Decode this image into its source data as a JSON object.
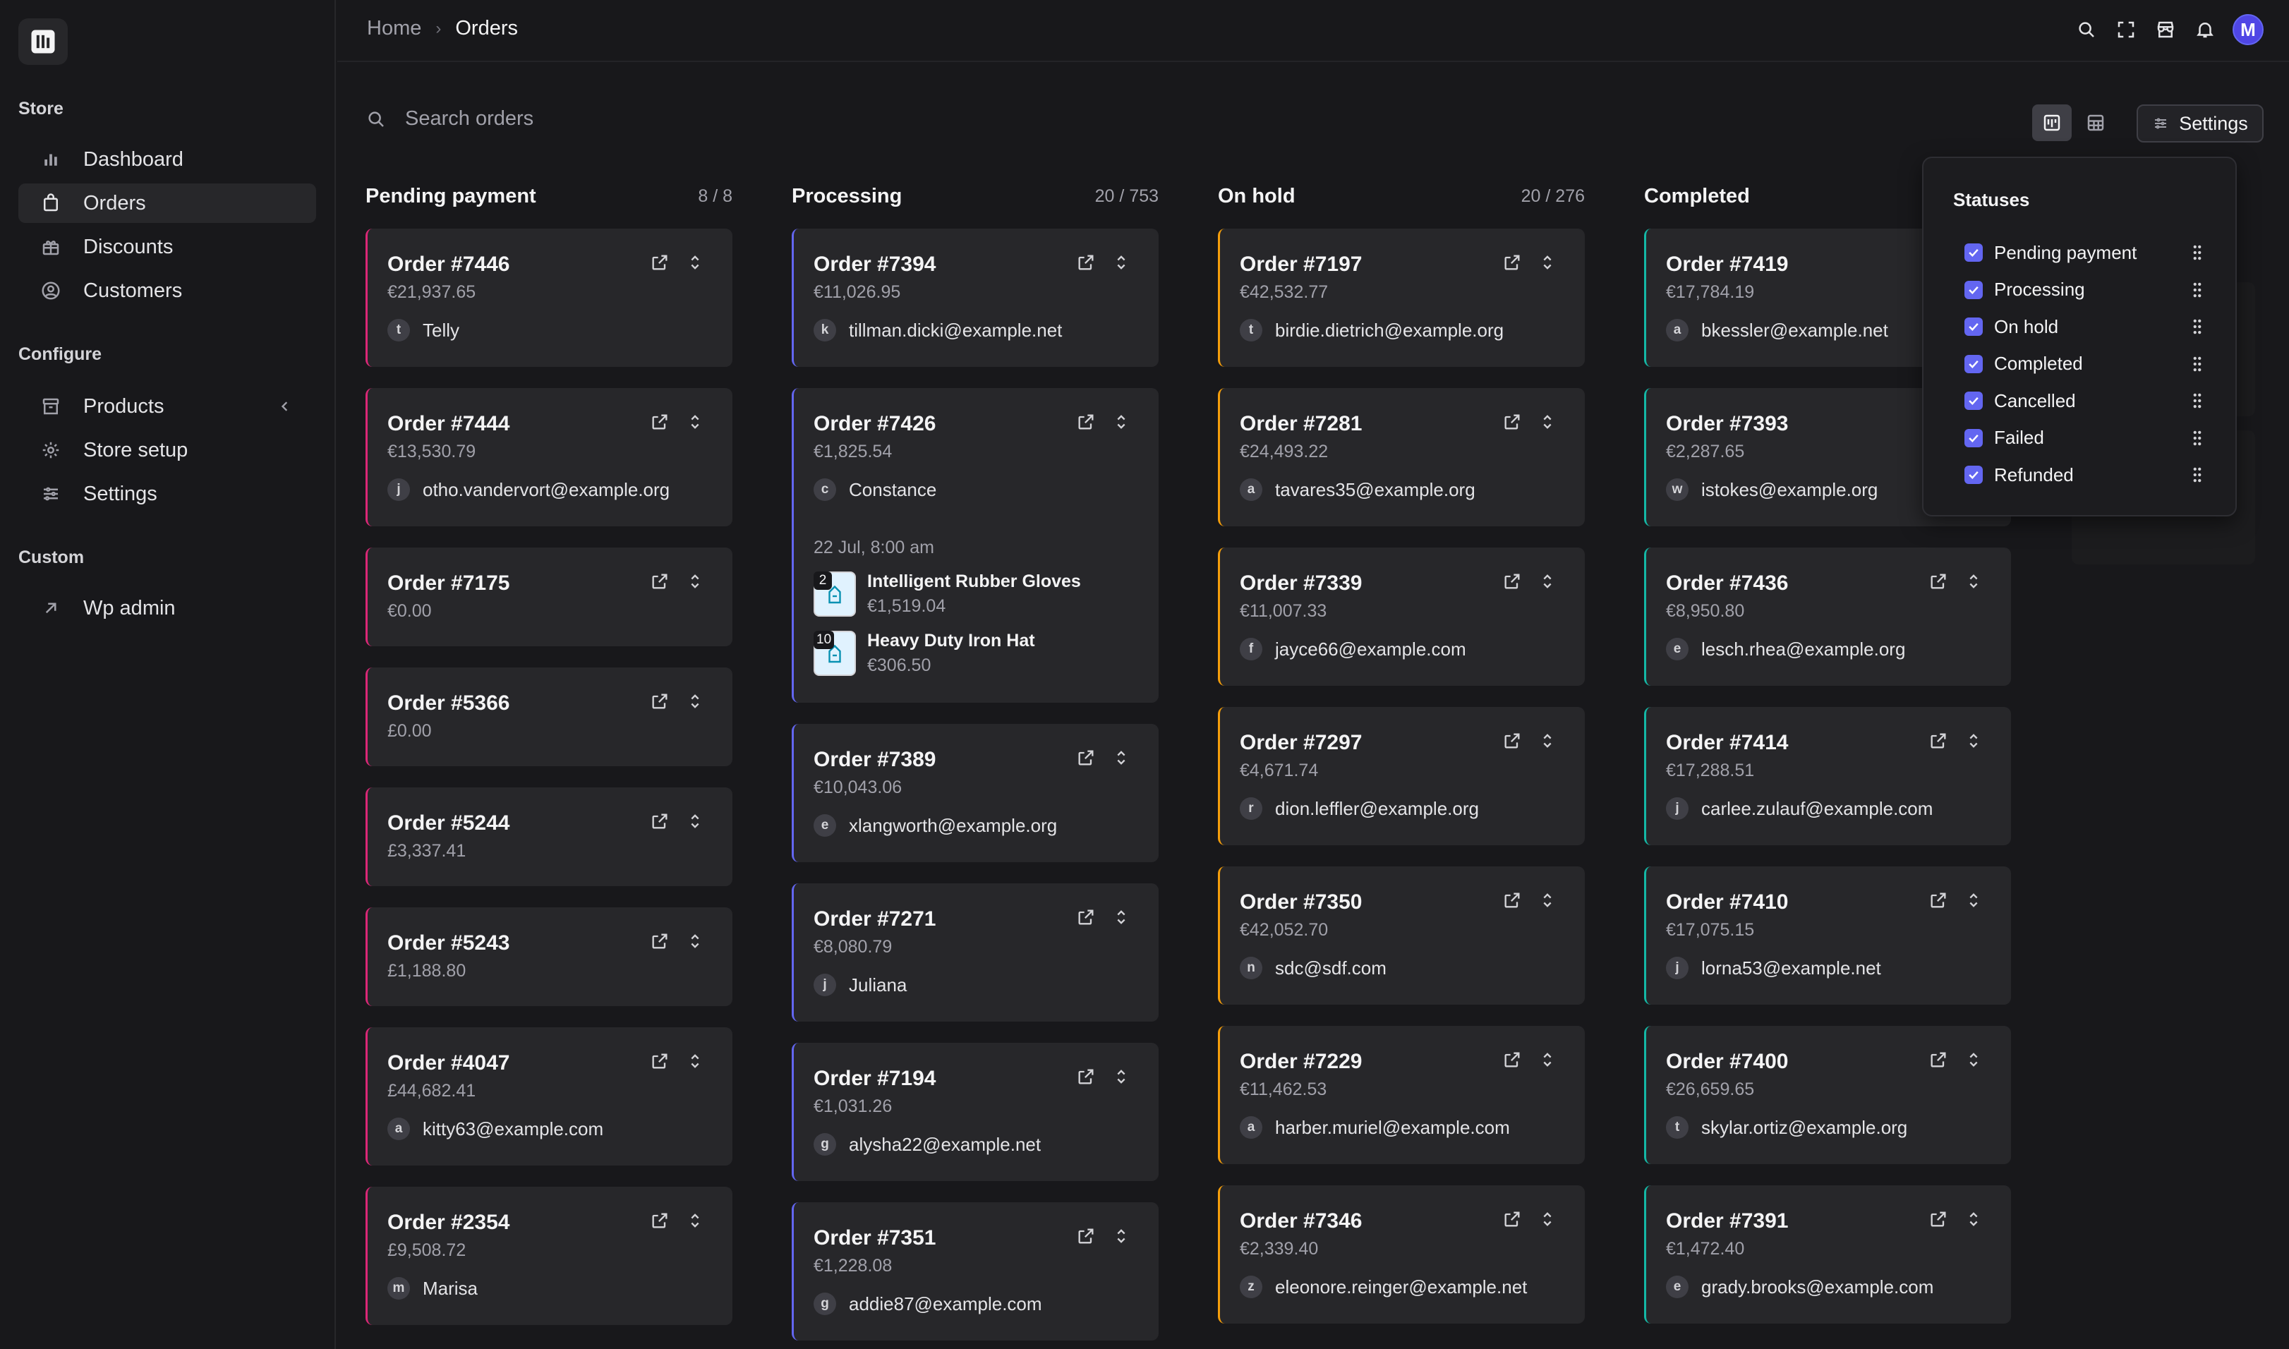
{
  "sidebar": {
    "groups": {
      "store": "Store",
      "configure": "Configure",
      "custom": "Custom"
    },
    "items": [
      {
        "label": "Dashboard",
        "icon": "bar-chart-icon"
      },
      {
        "label": "Orders",
        "icon": "shopping-bag-icon",
        "active": true
      },
      {
        "label": "Discounts",
        "icon": "gift-icon"
      },
      {
        "label": "Customers",
        "icon": "user-circle-icon"
      },
      {
        "label": "Products",
        "icon": "archive-icon"
      },
      {
        "label": "Store setup",
        "icon": "gear-icon"
      },
      {
        "label": "Settings",
        "icon": "sliders-icon"
      },
      {
        "label": "Wp admin",
        "icon": "arrow-up-right-icon"
      }
    ]
  },
  "header": {
    "breadcrumb_home": "Home",
    "breadcrumb_current": "Orders",
    "avatar_initial": "M"
  },
  "toolbar": {
    "search_placeholder": "Search orders",
    "settings_label": "Settings"
  },
  "columns": [
    {
      "title": "Pending payment",
      "count": "8 / 8",
      "accent": "#db2777",
      "cards": [
        {
          "id": "Order #7446",
          "amount": "€21,937.65",
          "initial": "t",
          "customer": "Telly"
        },
        {
          "id": "Order #7444",
          "amount": "€13,530.79",
          "initial": "j",
          "customer": "otho.vandervort@example.org"
        },
        {
          "id": "Order #7175",
          "amount": "€0.00"
        },
        {
          "id": "Order #5366",
          "amount": "£0.00"
        },
        {
          "id": "Order #5244",
          "amount": "£3,337.41"
        },
        {
          "id": "Order #5243",
          "amount": "£1,188.80"
        },
        {
          "id": "Order #4047",
          "amount": "£44,682.41",
          "initial": "a",
          "customer": "kitty63@example.com"
        },
        {
          "id": "Order #2354",
          "amount": "£9,508.72",
          "initial": "m",
          "customer": "Marisa"
        }
      ]
    },
    {
      "title": "Processing",
      "count": "20 / 753",
      "accent": "#6366f1",
      "cards": [
        {
          "id": "Order #7394",
          "amount": "€11,026.95",
          "initial": "k",
          "customer": "tillman.dicki@example.net"
        },
        {
          "id": "Order #7426",
          "amount": "€1,825.54",
          "initial": "c",
          "customer": "Constance",
          "date": "22 Jul, 8:00 am",
          "line_items": [
            {
              "qty": "2",
              "name": "Intelligent Rubber Gloves",
              "price": "€1,519.04"
            },
            {
              "qty": "10",
              "name": "Heavy Duty Iron Hat",
              "price": "€306.50"
            }
          ]
        },
        {
          "id": "Order #7389",
          "amount": "€10,043.06",
          "initial": "e",
          "customer": "xlangworth@example.org"
        },
        {
          "id": "Order #7271",
          "amount": "€8,080.79",
          "initial": "j",
          "customer": "Juliana"
        },
        {
          "id": "Order #7194",
          "amount": "€1,031.26",
          "initial": "g",
          "customer": "alysha22@example.net"
        },
        {
          "id": "Order #7351",
          "amount": "€1,228.08",
          "initial": "g",
          "customer": "addie87@example.com"
        }
      ]
    },
    {
      "title": "On hold",
      "count": "20 / 276",
      "accent": "#f59e0b",
      "cards": [
        {
          "id": "Order #7197",
          "amount": "€42,532.77",
          "initial": "t",
          "customer": "birdie.dietrich@example.org"
        },
        {
          "id": "Order #7281",
          "amount": "€24,493.22",
          "initial": "a",
          "customer": "tavares35@example.org"
        },
        {
          "id": "Order #7339",
          "amount": "€11,007.33",
          "initial": "f",
          "customer": "jayce66@example.com"
        },
        {
          "id": "Order #7297",
          "amount": "€4,671.74",
          "initial": "r",
          "customer": "dion.leffler@example.org"
        },
        {
          "id": "Order #7350",
          "amount": "€42,052.70",
          "initial": "n",
          "customer": "sdc@sdf.com"
        },
        {
          "id": "Order #7229",
          "amount": "€11,462.53",
          "initial": "a",
          "customer": "harber.muriel@example.com"
        },
        {
          "id": "Order #7346",
          "amount": "€2,339.40",
          "initial": "z",
          "customer": "eleonore.reinger@example.net"
        }
      ]
    },
    {
      "title": "Completed",
      "count": "",
      "accent": "#14b8a6",
      "cards": [
        {
          "id": "Order #7419",
          "amount": "€17,784.19",
          "initial": "a",
          "customer": "bkessler@example.net"
        },
        {
          "id": "Order #7393",
          "amount": "€2,287.65",
          "initial": "w",
          "customer": "istokes@example.org"
        },
        {
          "id": "Order #7436",
          "amount": "€8,950.80",
          "initial": "e",
          "customer": "lesch.rhea@example.org"
        },
        {
          "id": "Order #7414",
          "amount": "€17,288.51",
          "initial": "j",
          "customer": "carlee.zulauf@example.com"
        },
        {
          "id": "Order #7410",
          "amount": "€17,075.15",
          "initial": "j",
          "customer": "lorna53@example.net"
        },
        {
          "id": "Order #7400",
          "amount": "€26,659.65",
          "initial": "t",
          "customer": "skylar.ortiz@example.org"
        },
        {
          "id": "Order #7391",
          "amount": "€1,472.40",
          "initial": "e",
          "customer": "grady.brooks@example.com"
        }
      ]
    }
  ],
  "statuses_popover": {
    "title": "Statuses",
    "items": [
      "Pending payment",
      "Processing",
      "On hold",
      "Completed",
      "Cancelled",
      "Failed",
      "Refunded"
    ]
  }
}
